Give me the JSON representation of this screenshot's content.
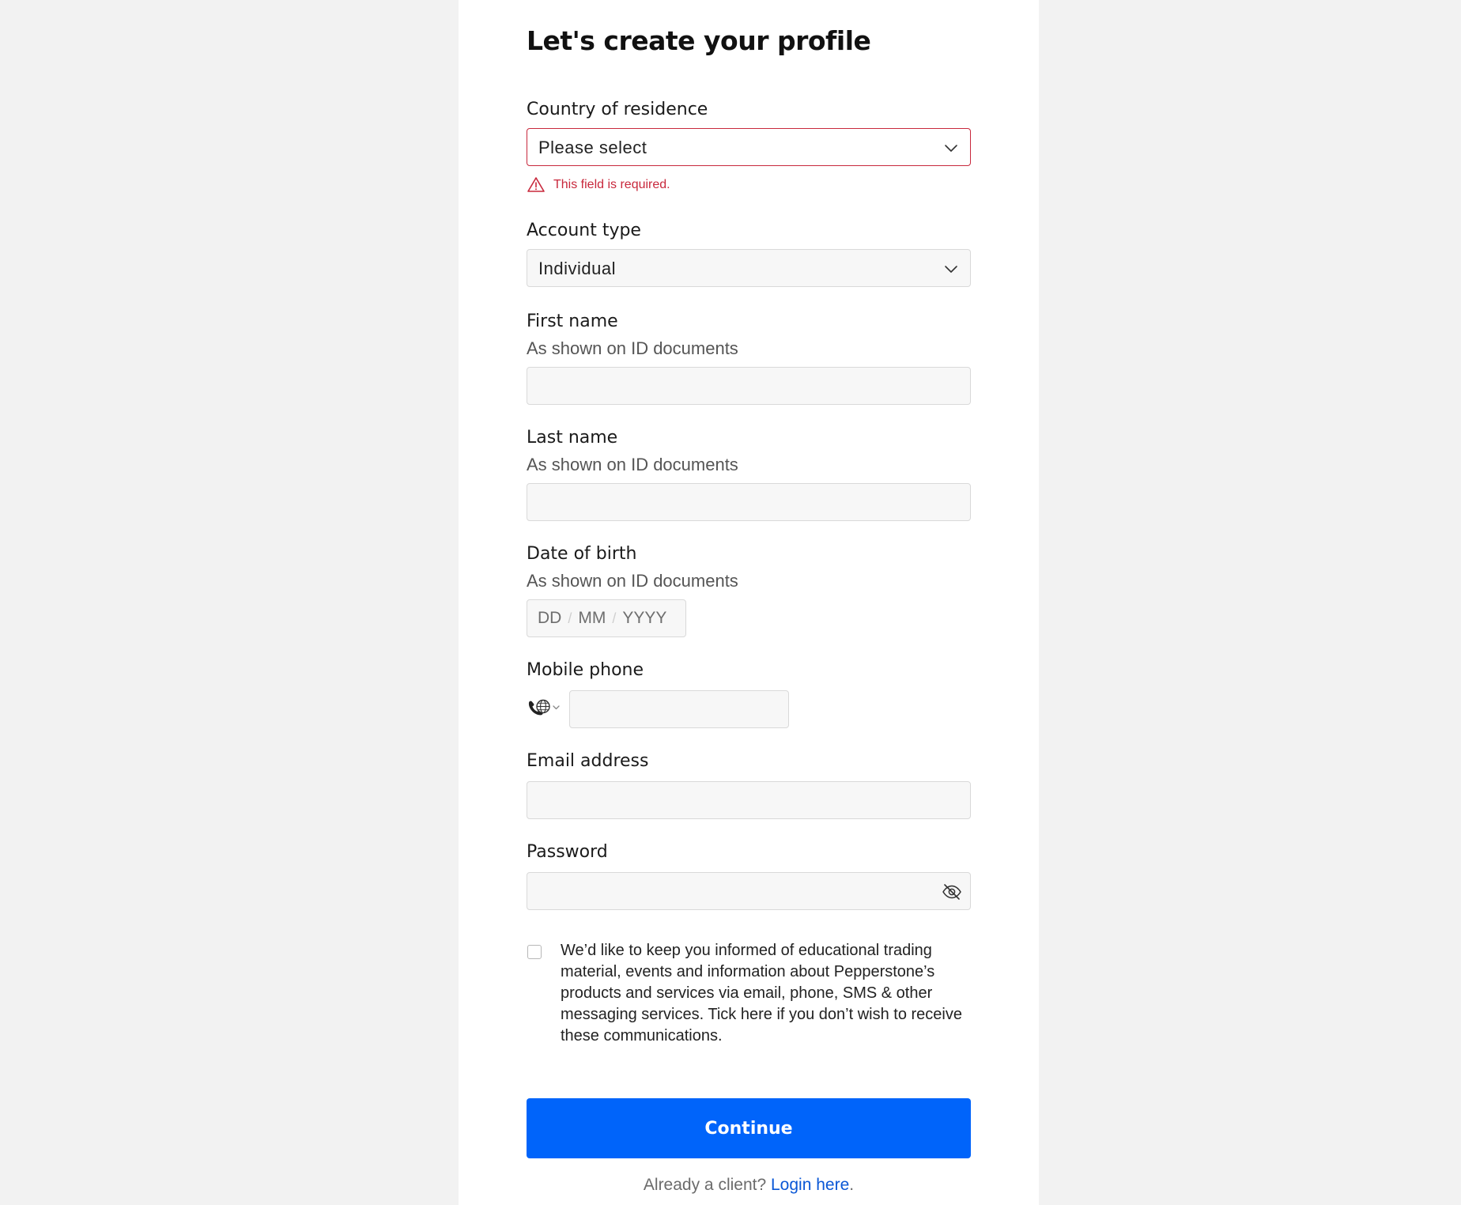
{
  "page": {
    "title": "Let's create your profile"
  },
  "country": {
    "label": "Country of residence",
    "value": "Please select",
    "error": "This field is required."
  },
  "account_type": {
    "label": "Account type",
    "value": "Individual"
  },
  "first_name": {
    "label": "First name",
    "hint": "As shown on ID documents",
    "value": ""
  },
  "last_name": {
    "label": "Last name",
    "hint": "As shown on ID documents",
    "value": ""
  },
  "dob": {
    "label": "Date of birth",
    "hint": "As shown on ID documents",
    "day_placeholder": "DD",
    "month_placeholder": "MM",
    "year_placeholder": "YYYY",
    "separator": "/"
  },
  "mobile": {
    "label": "Mobile phone",
    "country_icon": "globe-phone-icon",
    "value": ""
  },
  "email": {
    "label": "Email address",
    "value": ""
  },
  "password": {
    "label": "Password",
    "value": "",
    "toggle_icon": "eye-slash-icon"
  },
  "consent": {
    "checked": false,
    "text": "We’d like to keep you informed of educational trading material, events and information about Pepperstone’s products and services via email, phone, SMS & other messaging services. Tick here if you don’t wish to receive these communications."
  },
  "actions": {
    "continue_label": "Continue",
    "already_client_text": "Already a client?",
    "login_link": "Login here",
    "login_suffix": "."
  },
  "colors": {
    "page_bg": "#f2f2f2",
    "panel_bg": "#ffffff",
    "primary": "#0064fa",
    "error": "#c8283c",
    "link": "#0a57d6"
  }
}
